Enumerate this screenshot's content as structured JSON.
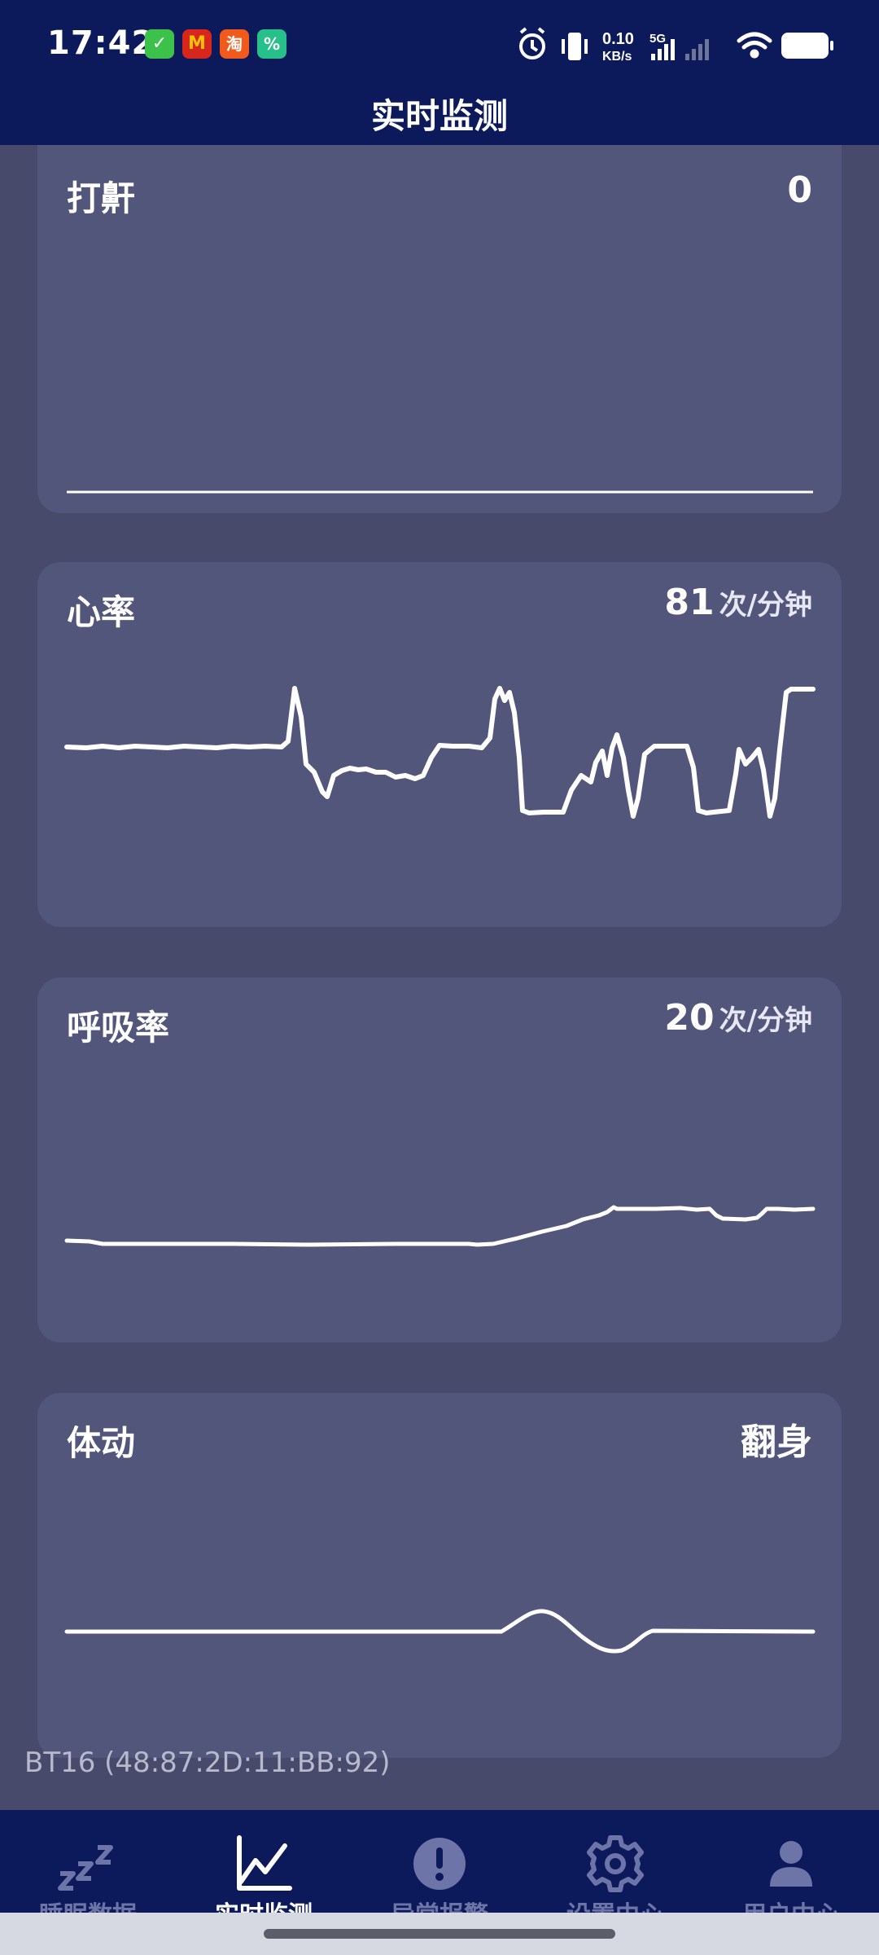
{
  "status_bar": {
    "time": "17:42",
    "network_speed": "0.10",
    "network_speed_unit": "KB/s",
    "network_type": "5G",
    "app_icons": [
      "wechat-like-icon",
      "mcdonalds-icon",
      "taobao-icon",
      "app-percent-icon"
    ],
    "taobao_char": "淘",
    "percent_char": "%"
  },
  "header": {
    "title": "实时监测"
  },
  "cards": {
    "snore": {
      "title": "打鼾",
      "value": "0",
      "unit": ""
    },
    "heart": {
      "title": "心率",
      "value": "81",
      "unit": "次/分钟"
    },
    "breath": {
      "title": "呼吸率",
      "value": "20",
      "unit": "次/分钟"
    },
    "motion": {
      "title": "体动",
      "value": "翻身",
      "unit": ""
    }
  },
  "device": {
    "id": "BT16 (48:87:2D:11:BB:92)"
  },
  "nav": {
    "items": [
      {
        "label": "睡眠数据",
        "icon": "sleep-zzz-icon",
        "active": false
      },
      {
        "label": "实时监测",
        "icon": "line-chart-icon",
        "active": true
      },
      {
        "label": "异常报警",
        "icon": "alert-icon",
        "active": false
      },
      {
        "label": "设置中心",
        "icon": "gear-icon",
        "active": false
      },
      {
        "label": "用户中心",
        "icon": "user-icon",
        "active": false
      }
    ]
  },
  "colors": {
    "header_bg": "#0c1a5b",
    "page_bg": "#474a6b",
    "card_bg": "#51567a",
    "wave": "#ffffff",
    "nav_inactive": "#6d74a8",
    "nav_active": "#ffffff"
  }
}
